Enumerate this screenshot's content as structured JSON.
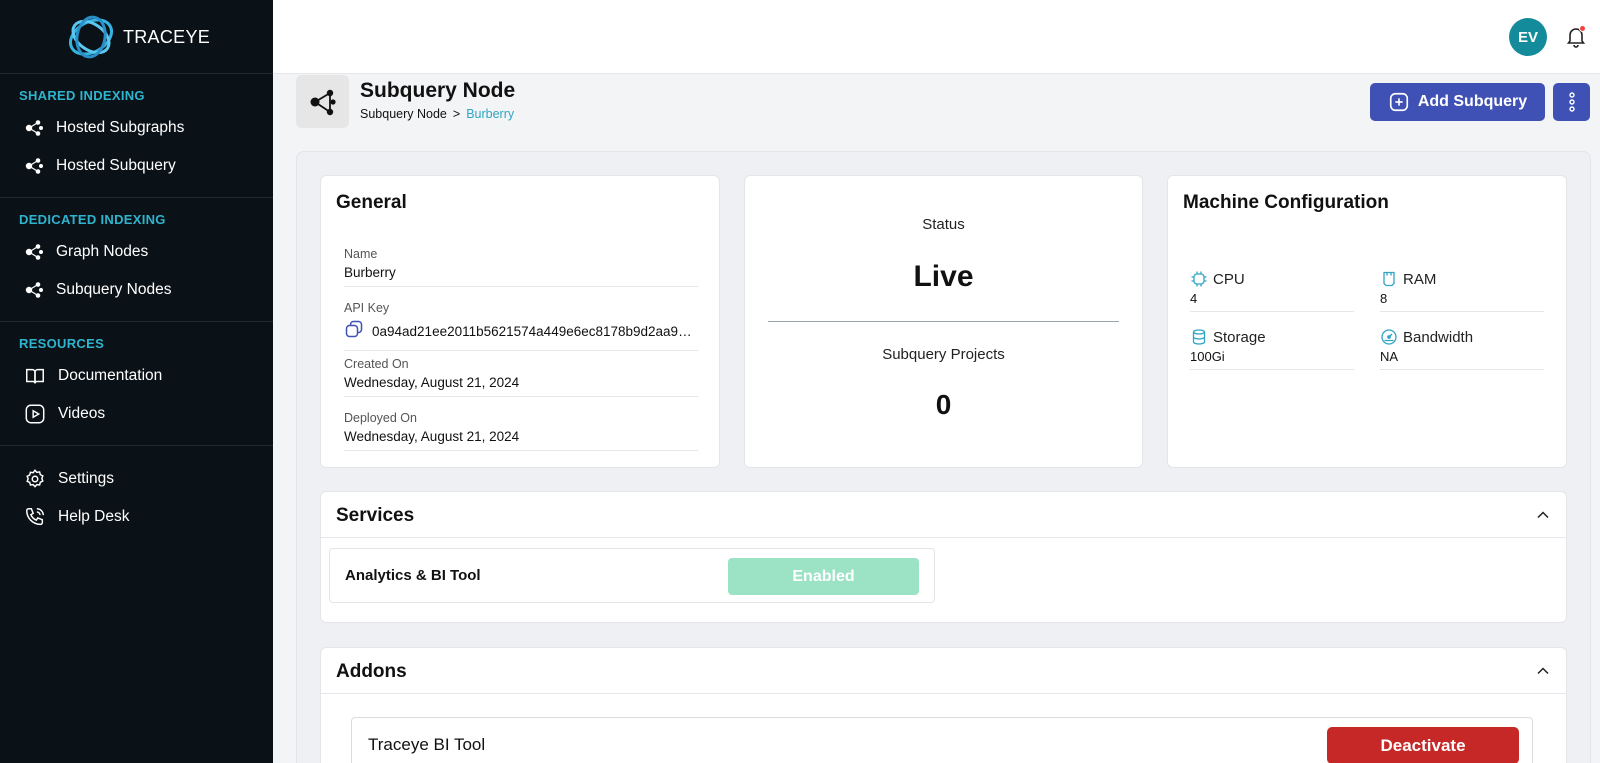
{
  "app": {
    "logo_text": "TRACEYE"
  },
  "sidebar": {
    "sections": [
      {
        "title": "SHARED INDEXING",
        "items": [
          {
            "label": "Hosted Subgraphs",
            "icon": "nodes-icon"
          },
          {
            "label": "Hosted Subquery",
            "icon": "nodes-icon"
          }
        ]
      },
      {
        "title": "DEDICATED INDEXING",
        "items": [
          {
            "label": "Graph Nodes",
            "icon": "nodes-icon"
          },
          {
            "label": "Subquery Nodes",
            "icon": "nodes-icon"
          }
        ]
      },
      {
        "title": "RESOURCES",
        "items": [
          {
            "label": "Documentation",
            "icon": "book-icon"
          },
          {
            "label": "Videos",
            "icon": "play-icon"
          }
        ]
      }
    ],
    "footer_items": [
      {
        "label": "Settings",
        "icon": "gear-icon"
      },
      {
        "label": "Help Desk",
        "icon": "phone-icon"
      }
    ]
  },
  "topbar": {
    "avatar_initials": "EV",
    "has_notification": true
  },
  "header": {
    "title": "Subquery Node",
    "breadcrumb": {
      "parent": "Subquery Node",
      "separator": ">",
      "current": "Burberry"
    },
    "add_button": "Add Subquery"
  },
  "general": {
    "title": "General",
    "fields": {
      "name_label": "Name",
      "name_value": "Burberry",
      "api_label": "API Key",
      "api_value": "0a94ad21ee2011b5621574a449e6ec8178b9d2aa99...",
      "created_label": "Created On",
      "created_value": "Wednesday, August 21, 2024",
      "deployed_label": "Deployed On",
      "deployed_value": "Wednesday, August 21, 2024"
    }
  },
  "status": {
    "label": "Status",
    "value": "Live",
    "projects_label": "Subquery Projects",
    "projects_value": "0"
  },
  "machine": {
    "title": "Machine Configuration",
    "specs": {
      "cpu_label": "CPU",
      "cpu_value": "4",
      "ram_label": "RAM",
      "ram_value": "8",
      "storage_label": "Storage",
      "storage_value": "100Gi",
      "bandwidth_label": "Bandwidth",
      "bandwidth_value": "NA"
    }
  },
  "services": {
    "title": "Services",
    "item_name": "Analytics & BI Tool",
    "item_state": "Enabled"
  },
  "addons": {
    "title": "Addons",
    "item_name": "Traceye BI Tool",
    "item_action": "Deactivate"
  },
  "colors": {
    "accent": "#3f51b5",
    "sidebar_bg": "#0b1217",
    "section_title": "#2fb4cf",
    "enabled": "#9ce3c6",
    "danger": "#c62828",
    "avatar": "#138b9b"
  }
}
